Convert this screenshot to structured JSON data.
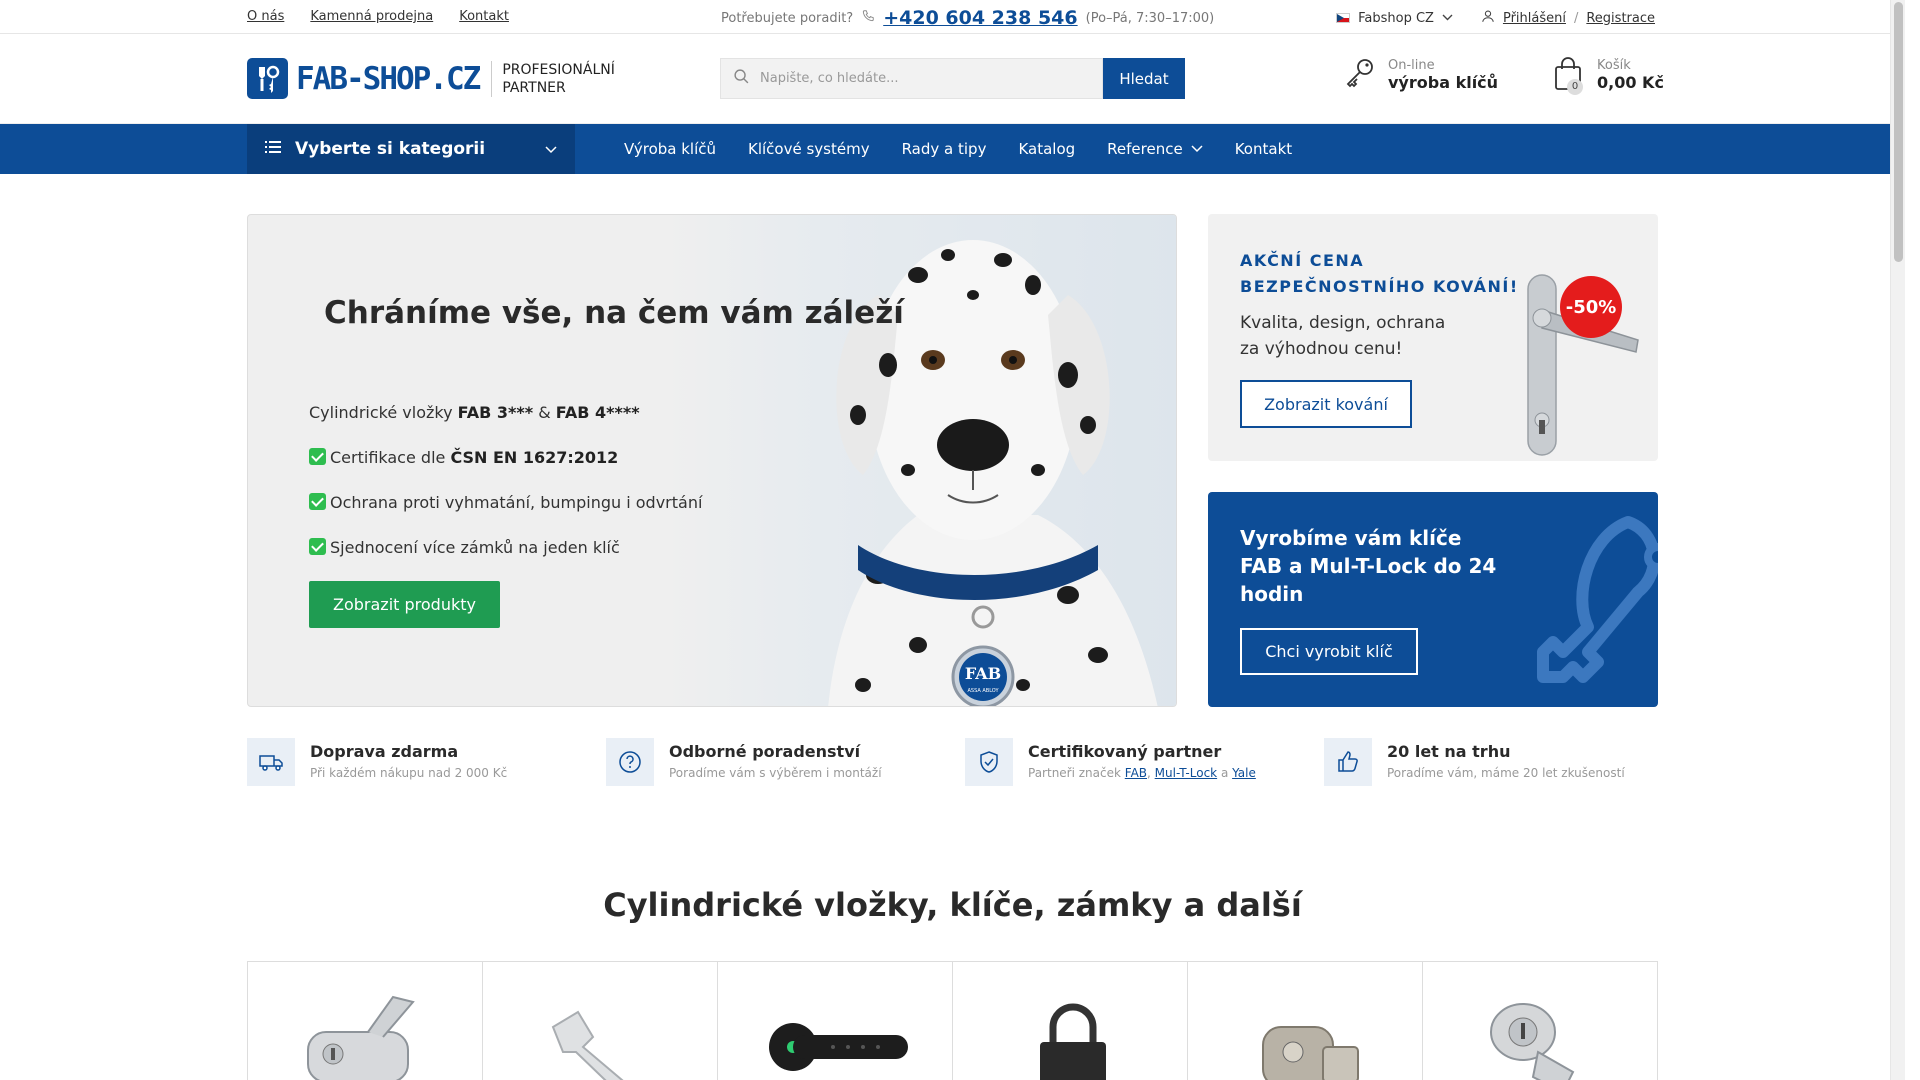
{
  "topbar": {
    "links": [
      "O nás",
      "Kamenná prodejna",
      "Kontakt"
    ],
    "help_text": "Potřebujete poradit?",
    "phone": "+420 604 238 546",
    "hours": "(Po–Pá, 7:30–17:00)",
    "shop": "Fabshop CZ",
    "login": "Přihlášení",
    "separator": "/",
    "register": "Registrace"
  },
  "header": {
    "logo_text": "FAB-SHOP.CZ",
    "tagline_1": "PROFESIONÁLNÍ",
    "tagline_2": "PARTNER",
    "search_placeholder": "Napište, co hledáte...",
    "search_button": "Hledat",
    "keys_small": "On-line",
    "keys_big": "výroba klíčů",
    "cart_small": "Košík",
    "cart_total": "0,00 Kč",
    "cart_count": "0"
  },
  "nav": {
    "category_label": "Vyberte si kategorii",
    "items": [
      "Výroba klíčů",
      "Klíčové systémy",
      "Rady a tipy",
      "Katalog",
      "Reference",
      "Kontakt"
    ]
  },
  "hero": {
    "title": "Chráníme vše, na čem vám záleží",
    "line1_a": "Cylindrické vložky ",
    "line1_b": "FAB 3***",
    "line1_c": " & ",
    "line1_d": "FAB 4****",
    "line2_a": "Certifikace dle ",
    "line2_b": "ČSN EN 1627:2012",
    "line3": "Ochrana proti vyhmatání, bumpingu i odvrtání",
    "line4": "Sjednocení více zámků na jeden klíč",
    "button": "Zobrazit produkty",
    "tag_text": "FAB",
    "tag_sub": "ASSA ABLOY"
  },
  "promo1": {
    "title_1": "AKČNÍ CENA",
    "title_2": "BEZPEČNOSTNÍHO KOVÁNÍ!",
    "text_1": "Kvalita, design, ochrana",
    "text_2": "za výhodnou cenu!",
    "button": "Zobrazit kování",
    "badge": "-50%"
  },
  "promo2": {
    "title": "Vyrobíme vám klíče FAB a Mul-T-Lock do 24 hodin",
    "button": "Chci vyrobit klíč"
  },
  "features": [
    {
      "title": "Doprava zdarma",
      "desc": "Při každém nákupu nad 2 000 Kč",
      "icon": "truck-icon"
    },
    {
      "title": "Odborné poradenství",
      "desc": "Poradíme vám s výběrem i montáží",
      "icon": "question-icon"
    },
    {
      "title": "Certifikovaný partner",
      "desc_pre": "Partneři značek ",
      "brand1": "FAB",
      "comma": ",",
      "brand2": "Mul-T-Lock",
      "and": " a ",
      "brand3": "Yale",
      "icon": "shield-icon"
    },
    {
      "title": "20 let na trhu",
      "desc": "Poradíme vám, máme 20 let zkušeností",
      "icon": "thumbs-up-icon"
    }
  ],
  "section": {
    "title": "Cylindrické vložky, klíče, zámky a další"
  },
  "colors": {
    "brand_blue": "#0d4d97",
    "cta_green": "#1f9c52",
    "sale_red": "#e41c1c"
  }
}
